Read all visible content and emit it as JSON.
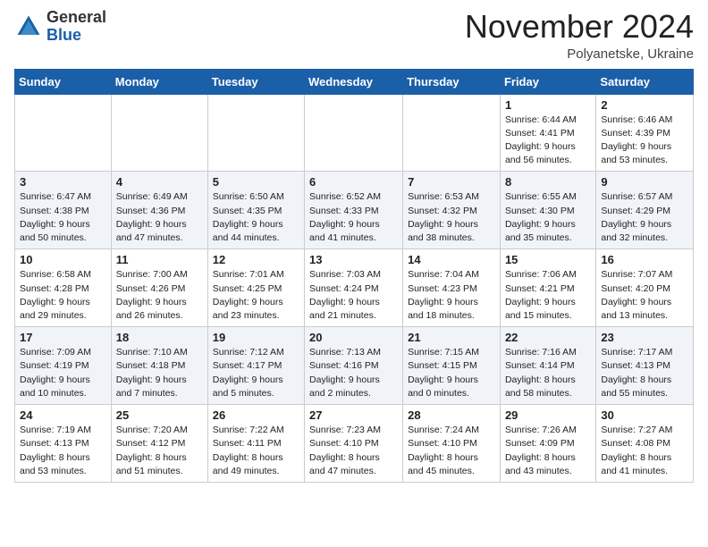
{
  "header": {
    "logo_general": "General",
    "logo_blue": "Blue",
    "month_title": "November 2024",
    "location": "Polyanetske, Ukraine"
  },
  "weekdays": [
    "Sunday",
    "Monday",
    "Tuesday",
    "Wednesday",
    "Thursday",
    "Friday",
    "Saturday"
  ],
  "weeks": [
    [
      {
        "day": "",
        "info": ""
      },
      {
        "day": "",
        "info": ""
      },
      {
        "day": "",
        "info": ""
      },
      {
        "day": "",
        "info": ""
      },
      {
        "day": "",
        "info": ""
      },
      {
        "day": "1",
        "info": "Sunrise: 6:44 AM\nSunset: 4:41 PM\nDaylight: 9 hours\nand 56 minutes."
      },
      {
        "day": "2",
        "info": "Sunrise: 6:46 AM\nSunset: 4:39 PM\nDaylight: 9 hours\nand 53 minutes."
      }
    ],
    [
      {
        "day": "3",
        "info": "Sunrise: 6:47 AM\nSunset: 4:38 PM\nDaylight: 9 hours\nand 50 minutes."
      },
      {
        "day": "4",
        "info": "Sunrise: 6:49 AM\nSunset: 4:36 PM\nDaylight: 9 hours\nand 47 minutes."
      },
      {
        "day": "5",
        "info": "Sunrise: 6:50 AM\nSunset: 4:35 PM\nDaylight: 9 hours\nand 44 minutes."
      },
      {
        "day": "6",
        "info": "Sunrise: 6:52 AM\nSunset: 4:33 PM\nDaylight: 9 hours\nand 41 minutes."
      },
      {
        "day": "7",
        "info": "Sunrise: 6:53 AM\nSunset: 4:32 PM\nDaylight: 9 hours\nand 38 minutes."
      },
      {
        "day": "8",
        "info": "Sunrise: 6:55 AM\nSunset: 4:30 PM\nDaylight: 9 hours\nand 35 minutes."
      },
      {
        "day": "9",
        "info": "Sunrise: 6:57 AM\nSunset: 4:29 PM\nDaylight: 9 hours\nand 32 minutes."
      }
    ],
    [
      {
        "day": "10",
        "info": "Sunrise: 6:58 AM\nSunset: 4:28 PM\nDaylight: 9 hours\nand 29 minutes."
      },
      {
        "day": "11",
        "info": "Sunrise: 7:00 AM\nSunset: 4:26 PM\nDaylight: 9 hours\nand 26 minutes."
      },
      {
        "day": "12",
        "info": "Sunrise: 7:01 AM\nSunset: 4:25 PM\nDaylight: 9 hours\nand 23 minutes."
      },
      {
        "day": "13",
        "info": "Sunrise: 7:03 AM\nSunset: 4:24 PM\nDaylight: 9 hours\nand 21 minutes."
      },
      {
        "day": "14",
        "info": "Sunrise: 7:04 AM\nSunset: 4:23 PM\nDaylight: 9 hours\nand 18 minutes."
      },
      {
        "day": "15",
        "info": "Sunrise: 7:06 AM\nSunset: 4:21 PM\nDaylight: 9 hours\nand 15 minutes."
      },
      {
        "day": "16",
        "info": "Sunrise: 7:07 AM\nSunset: 4:20 PM\nDaylight: 9 hours\nand 13 minutes."
      }
    ],
    [
      {
        "day": "17",
        "info": "Sunrise: 7:09 AM\nSunset: 4:19 PM\nDaylight: 9 hours\nand 10 minutes."
      },
      {
        "day": "18",
        "info": "Sunrise: 7:10 AM\nSunset: 4:18 PM\nDaylight: 9 hours\nand 7 minutes."
      },
      {
        "day": "19",
        "info": "Sunrise: 7:12 AM\nSunset: 4:17 PM\nDaylight: 9 hours\nand 5 minutes."
      },
      {
        "day": "20",
        "info": "Sunrise: 7:13 AM\nSunset: 4:16 PM\nDaylight: 9 hours\nand 2 minutes."
      },
      {
        "day": "21",
        "info": "Sunrise: 7:15 AM\nSunset: 4:15 PM\nDaylight: 9 hours\nand 0 minutes."
      },
      {
        "day": "22",
        "info": "Sunrise: 7:16 AM\nSunset: 4:14 PM\nDaylight: 8 hours\nand 58 minutes."
      },
      {
        "day": "23",
        "info": "Sunrise: 7:17 AM\nSunset: 4:13 PM\nDaylight: 8 hours\nand 55 minutes."
      }
    ],
    [
      {
        "day": "24",
        "info": "Sunrise: 7:19 AM\nSunset: 4:13 PM\nDaylight: 8 hours\nand 53 minutes."
      },
      {
        "day": "25",
        "info": "Sunrise: 7:20 AM\nSunset: 4:12 PM\nDaylight: 8 hours\nand 51 minutes."
      },
      {
        "day": "26",
        "info": "Sunrise: 7:22 AM\nSunset: 4:11 PM\nDaylight: 8 hours\nand 49 minutes."
      },
      {
        "day": "27",
        "info": "Sunrise: 7:23 AM\nSunset: 4:10 PM\nDaylight: 8 hours\nand 47 minutes."
      },
      {
        "day": "28",
        "info": "Sunrise: 7:24 AM\nSunset: 4:10 PM\nDaylight: 8 hours\nand 45 minutes."
      },
      {
        "day": "29",
        "info": "Sunrise: 7:26 AM\nSunset: 4:09 PM\nDaylight: 8 hours\nand 43 minutes."
      },
      {
        "day": "30",
        "info": "Sunrise: 7:27 AM\nSunset: 4:08 PM\nDaylight: 8 hours\nand 41 minutes."
      }
    ]
  ]
}
